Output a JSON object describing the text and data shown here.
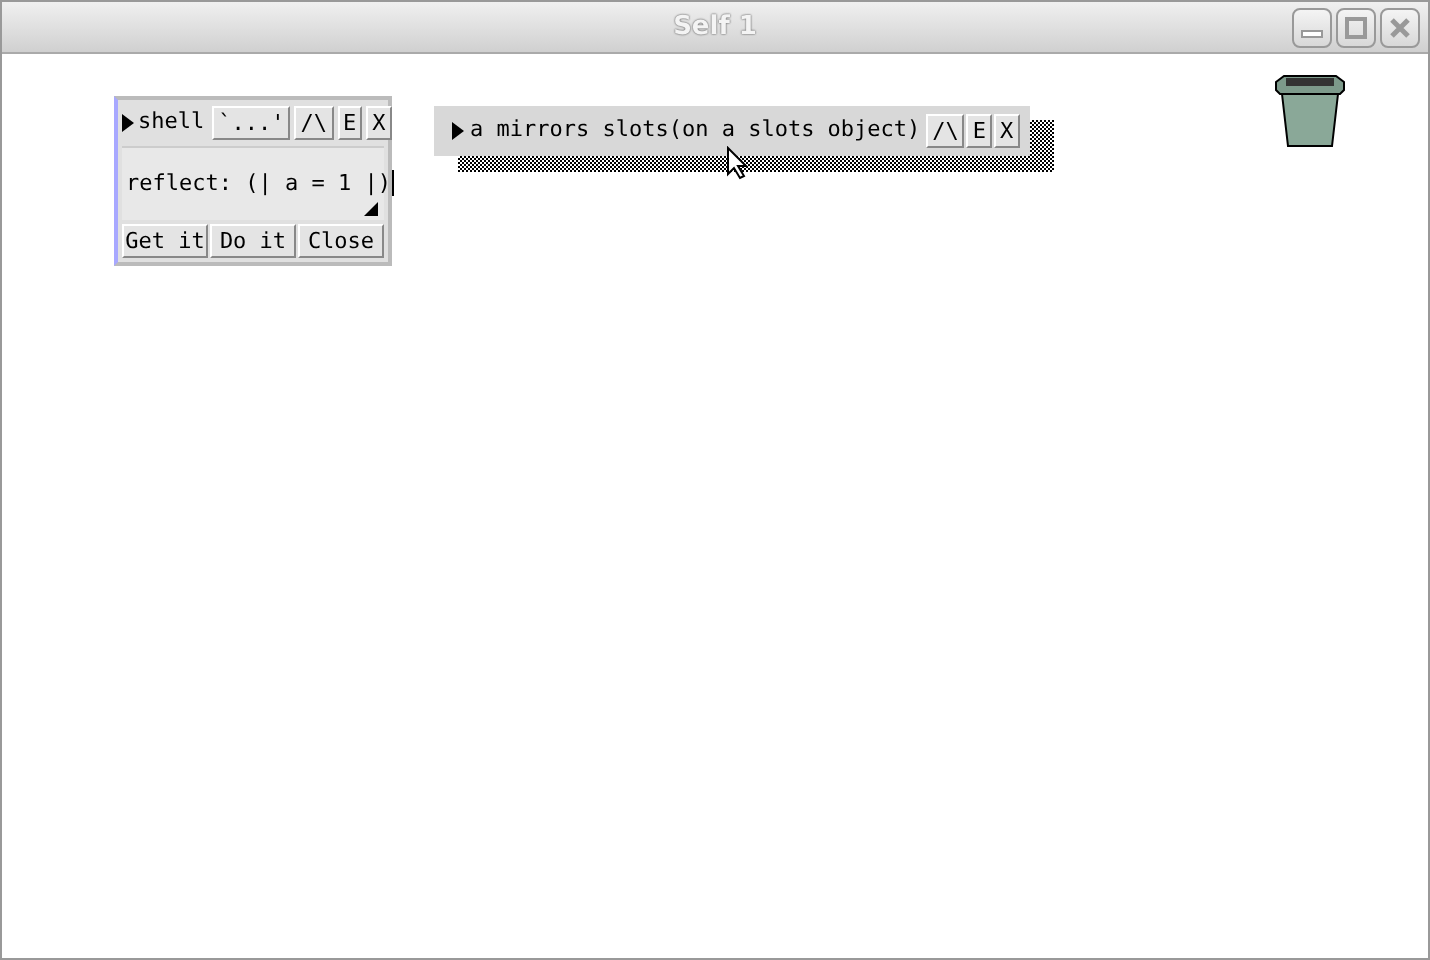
{
  "window": {
    "title": "Self 1"
  },
  "shell": {
    "title": "shell",
    "buttons": [
      "`...'",
      "/\\",
      "E",
      "X"
    ],
    "expression": "reflect: (| a = 1 |)",
    "actions": [
      "Get it",
      "Do it",
      "Close"
    ]
  },
  "outliner": {
    "title": "a mirrors slots(on a slots object)",
    "buttons": [
      "/\\",
      "E",
      "X"
    ]
  }
}
